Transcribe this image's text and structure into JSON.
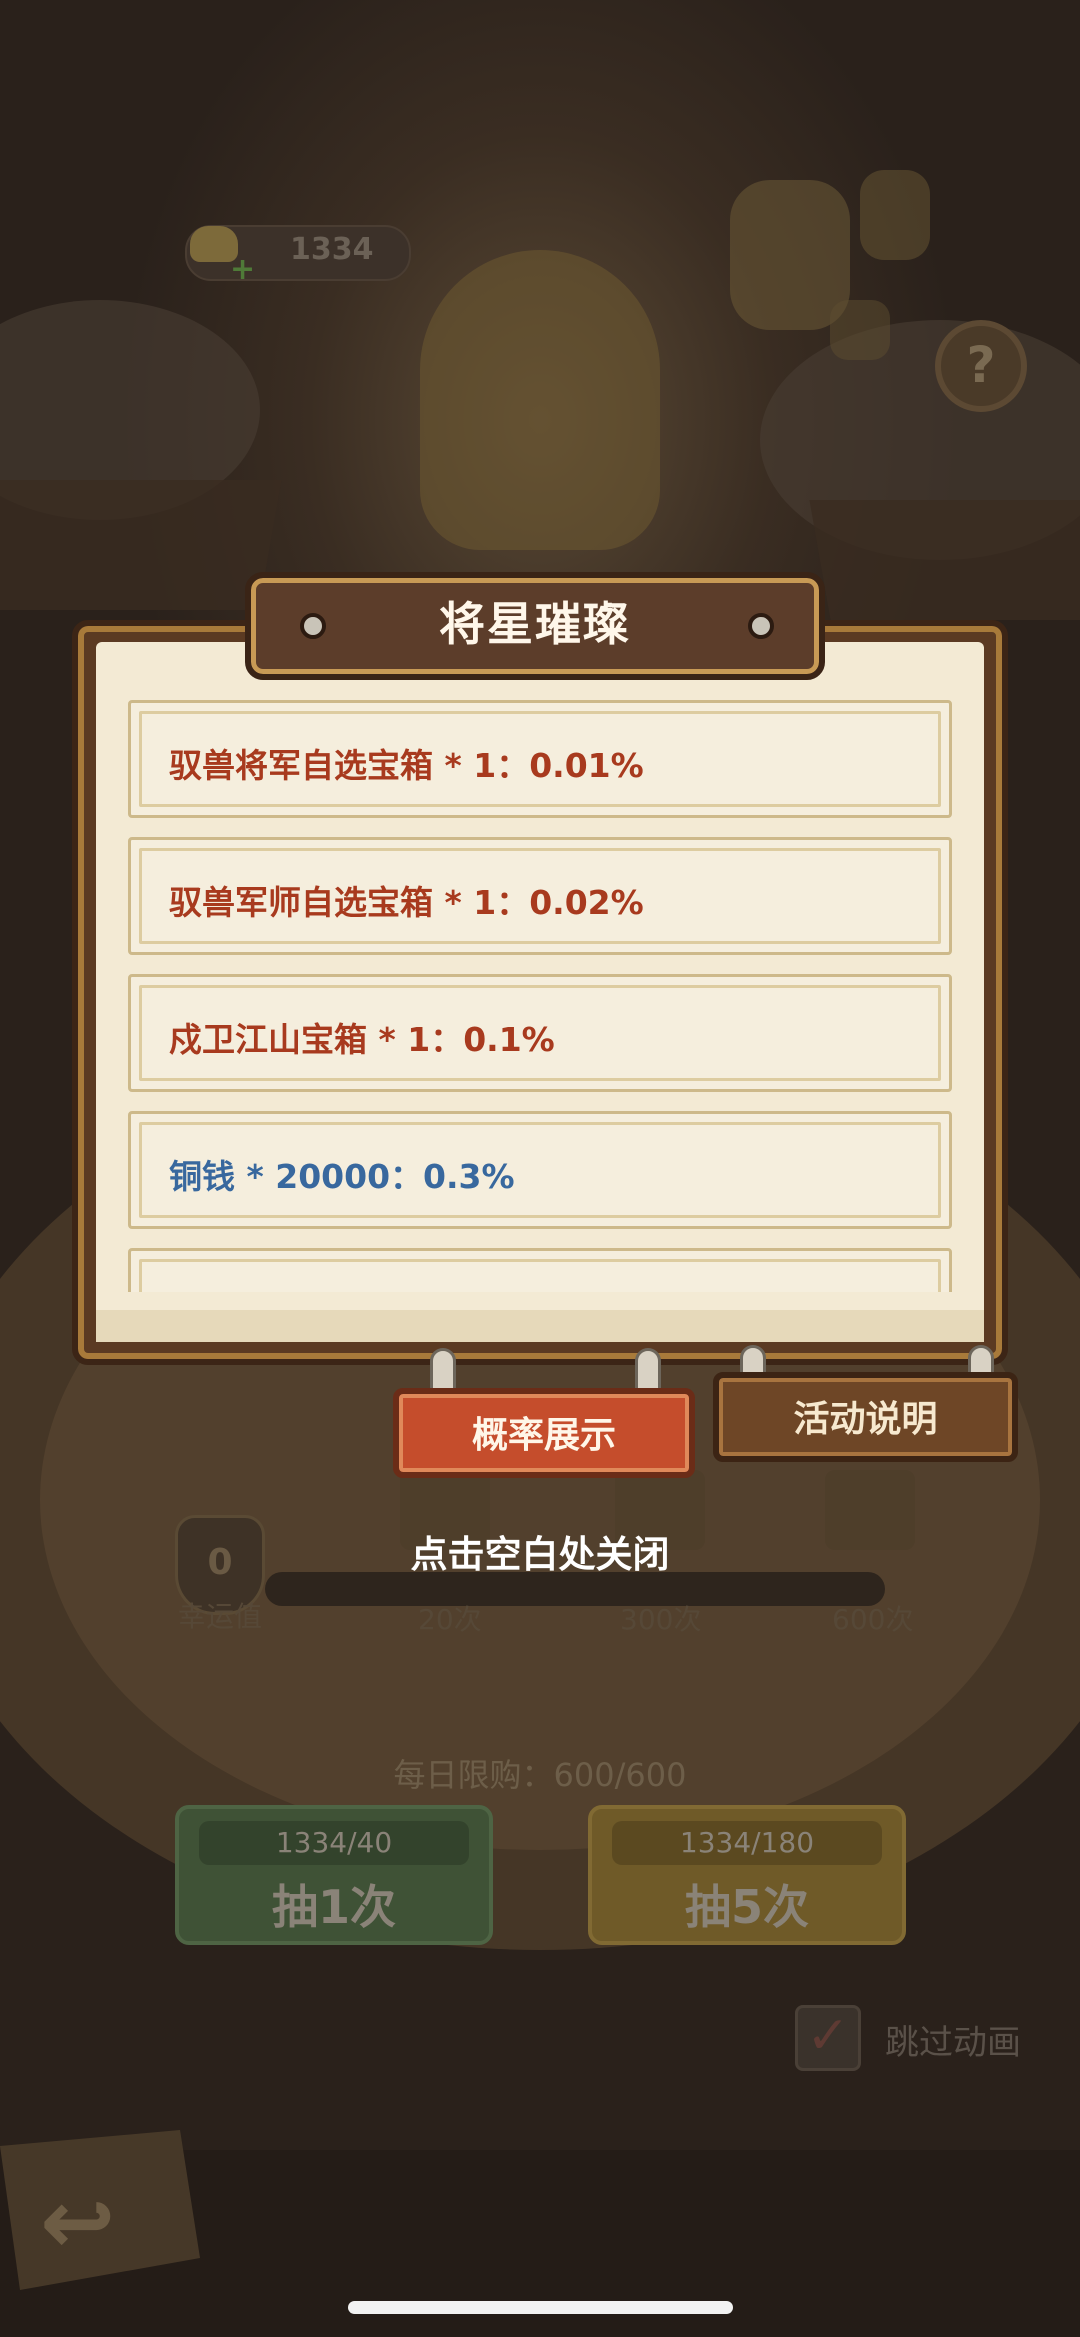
{
  "header": {
    "currency_value": "1334"
  },
  "modal": {
    "title": "将星璀璨",
    "items": [
      {
        "label": "驭兽将军自选宝箱 * 1：0.01%",
        "color": "#a83a1e"
      },
      {
        "label": "驭兽军师自选宝箱 * 1：0.02%",
        "color": "#a83a1e"
      },
      {
        "label": "戍卫江山宝箱 * 1：0.1%",
        "color": "#a83a1e"
      },
      {
        "label": "铜钱 * 20000：0.3%",
        "color": "#38689e"
      },
      {
        "label": "",
        "color": "#38689e"
      }
    ],
    "tabs": {
      "probability": "概率展示",
      "event_info": "活动说明"
    },
    "close_hint": "点击空白处关闭"
  },
  "luck": {
    "value": "0",
    "label": "幸运值",
    "milestones": [
      "20次",
      "300次",
      "600次"
    ]
  },
  "purchase": {
    "daily_limit": "每日限购：600/600",
    "draw_once": {
      "cost": "1334/40",
      "label": "抽1次"
    },
    "draw_five": {
      "cost": "1334/180",
      "label": "抽5次"
    }
  },
  "skip_animation": {
    "label": "跳过动画",
    "checked": true
  },
  "colors": {
    "accent_red": "#c54d2c",
    "panel_brown": "#5b3a22",
    "paper": "#f3ead4"
  }
}
